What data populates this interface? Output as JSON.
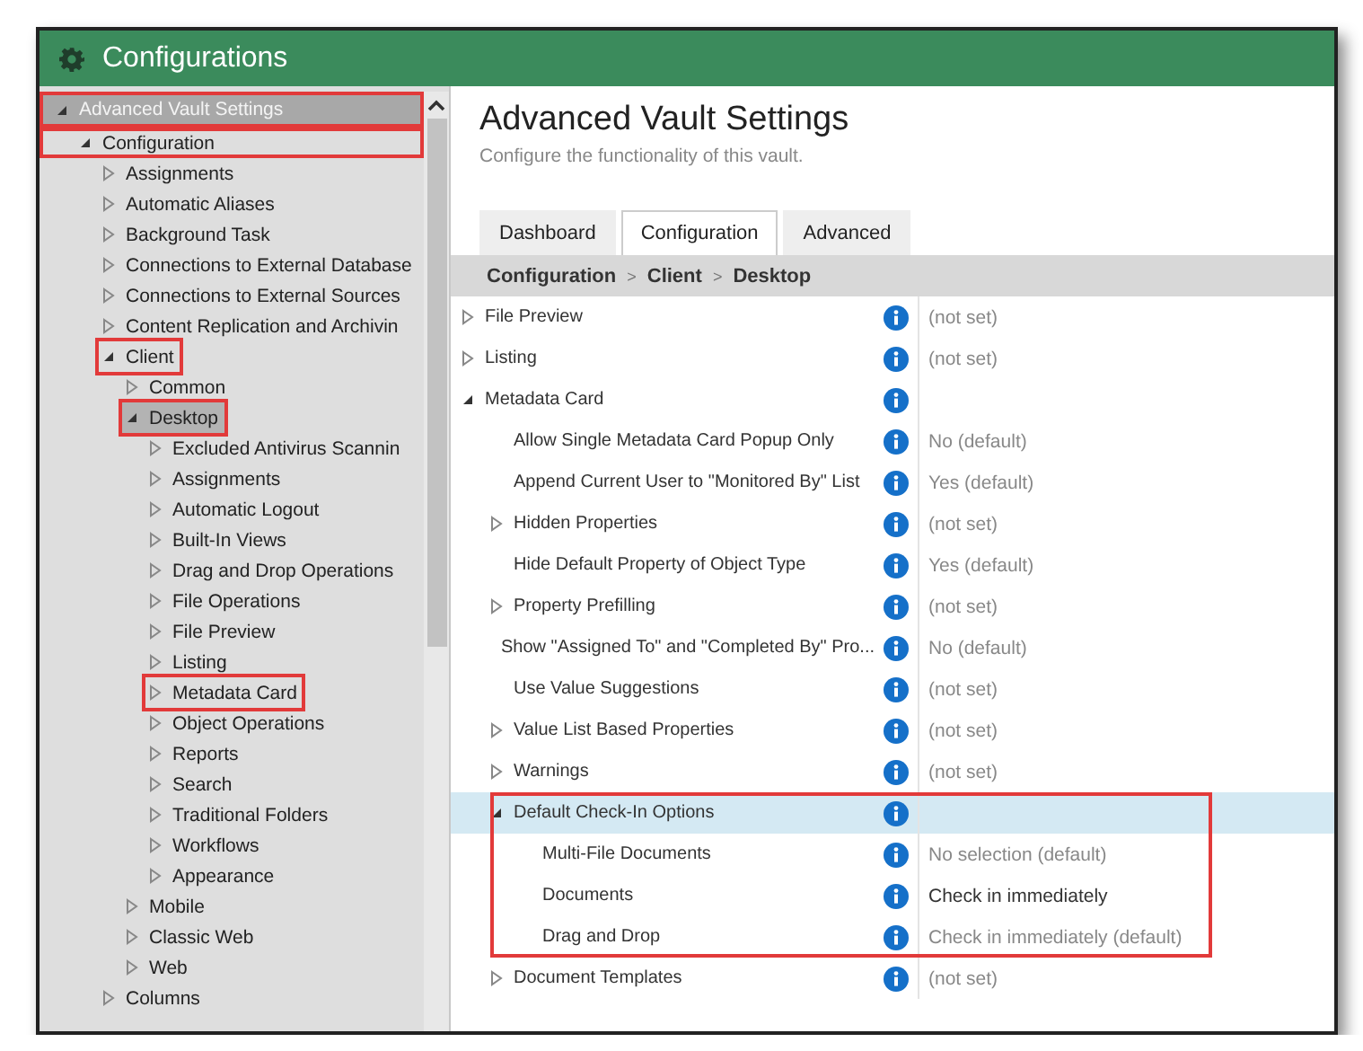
{
  "window": {
    "title": "Configurations"
  },
  "tree": [
    {
      "label": "Advanced Vault Settings",
      "expanded": true,
      "selected": false,
      "outlined": true,
      "children": [
        {
          "label": "Configuration",
          "expanded": true,
          "selected": false,
          "outlined": true,
          "children": [
            {
              "label": "Assignments",
              "expanded": false,
              "selected": false
            },
            {
              "label": "Automatic Aliases",
              "expanded": false,
              "selected": false
            },
            {
              "label": "Background Task",
              "expanded": false,
              "selected": false
            },
            {
              "label": "Connections to External Database",
              "expanded": false,
              "selected": false
            },
            {
              "label": "Connections to External Sources",
              "expanded": false,
              "selected": false
            },
            {
              "label": "Content Replication and Archivin",
              "expanded": false,
              "selected": false
            },
            {
              "label": "Client",
              "expanded": true,
              "selected": false,
              "outlined": true,
              "children": [
                {
                  "label": "Common",
                  "expanded": false,
                  "selected": false
                },
                {
                  "label": "Desktop",
                  "expanded": true,
                  "selected": true,
                  "outlined": true,
                  "children": [
                    {
                      "label": "Excluded Antivirus Scannin",
                      "expanded": false,
                      "selected": false
                    },
                    {
                      "label": "Assignments",
                      "expanded": false,
                      "selected": false
                    },
                    {
                      "label": "Automatic Logout",
                      "expanded": false,
                      "selected": false
                    },
                    {
                      "label": "Built-In Views",
                      "expanded": false,
                      "selected": false
                    },
                    {
                      "label": "Drag and Drop Operations",
                      "expanded": false,
                      "selected": false
                    },
                    {
                      "label": "File Operations",
                      "expanded": false,
                      "selected": false
                    },
                    {
                      "label": "File Preview",
                      "expanded": false,
                      "selected": false
                    },
                    {
                      "label": "Listing",
                      "expanded": false,
                      "selected": false
                    },
                    {
                      "label": "Metadata Card",
                      "expanded": false,
                      "selected": false,
                      "outlined": true
                    },
                    {
                      "label": "Object Operations",
                      "expanded": false,
                      "selected": false
                    },
                    {
                      "label": "Reports",
                      "expanded": false,
                      "selected": false
                    },
                    {
                      "label": "Search",
                      "expanded": false,
                      "selected": false
                    },
                    {
                      "label": "Traditional Folders",
                      "expanded": false,
                      "selected": false
                    },
                    {
                      "label": "Workflows",
                      "expanded": false,
                      "selected": false
                    },
                    {
                      "label": "Appearance",
                      "expanded": false,
                      "selected": false
                    }
                  ]
                },
                {
                  "label": "Mobile",
                  "expanded": false,
                  "selected": false
                },
                {
                  "label": "Classic Web",
                  "expanded": false,
                  "selected": false
                },
                {
                  "label": "Web",
                  "expanded": false,
                  "selected": false
                }
              ]
            },
            {
              "label": "Columns",
              "expanded": false,
              "selected": false
            }
          ]
        }
      ]
    }
  ],
  "page": {
    "title": "Advanced Vault Settings",
    "subtitle": "Configure the functionality of this vault."
  },
  "tabs": [
    {
      "label": "Dashboard",
      "selected": false
    },
    {
      "label": "Configuration",
      "selected": true
    },
    {
      "label": "Advanced",
      "selected": false
    }
  ],
  "breadcrumb": {
    "separator": ">",
    "items": [
      "Configuration",
      "Client",
      "Desktop"
    ]
  },
  "settings": [
    {
      "label": "File Preview",
      "expanded": false,
      "selected": false,
      "value": "(not set)"
    },
    {
      "label": "Listing",
      "expanded": false,
      "selected": false,
      "value": "(not set)"
    },
    {
      "label": "Metadata Card",
      "expanded": true,
      "selected": false,
      "children": [
        {
          "label": "Allow Single Metadata Card Popup Only",
          "selected": false,
          "value": "No (default)"
        },
        {
          "label": "Append Current User to \"Monitored By\" List",
          "selected": false,
          "value": "Yes (default)"
        },
        {
          "label": "Hidden Properties",
          "expanded": false,
          "selected": false,
          "value": "(not set)"
        },
        {
          "label": "Hide Default Property of Object Type",
          "selected": false,
          "value": "Yes (default)"
        },
        {
          "label": "Property Prefilling",
          "expanded": false,
          "selected": false,
          "value": "(not set)"
        },
        {
          "label": "Show \"Assigned To\" and \"Completed By\" Pro...",
          "selected": false,
          "value": "No (default)"
        },
        {
          "label": "Use Value Suggestions",
          "selected": false,
          "value": "(not set)"
        },
        {
          "label": "Value List Based Properties",
          "expanded": false,
          "selected": false,
          "value": "(not set)"
        },
        {
          "label": "Warnings",
          "expanded": false,
          "selected": false,
          "value": "(not set)"
        },
        {
          "label": "Default Check-In Options",
          "expanded": true,
          "selected": true,
          "outlined": true,
          "children": [
            {
              "label": "Multi-File Documents",
              "selected": false,
              "value": "No selection (default)"
            },
            {
              "label": "Documents",
              "selected": false,
              "value": "Check in immediately",
              "modified": true
            },
            {
              "label": "Drag and Drop",
              "selected": false,
              "value": "Check in immediately (default)"
            }
          ]
        },
        {
          "label": "Document Templates",
          "expanded": false,
          "selected": false,
          "value": "(not set)"
        }
      ]
    }
  ]
}
